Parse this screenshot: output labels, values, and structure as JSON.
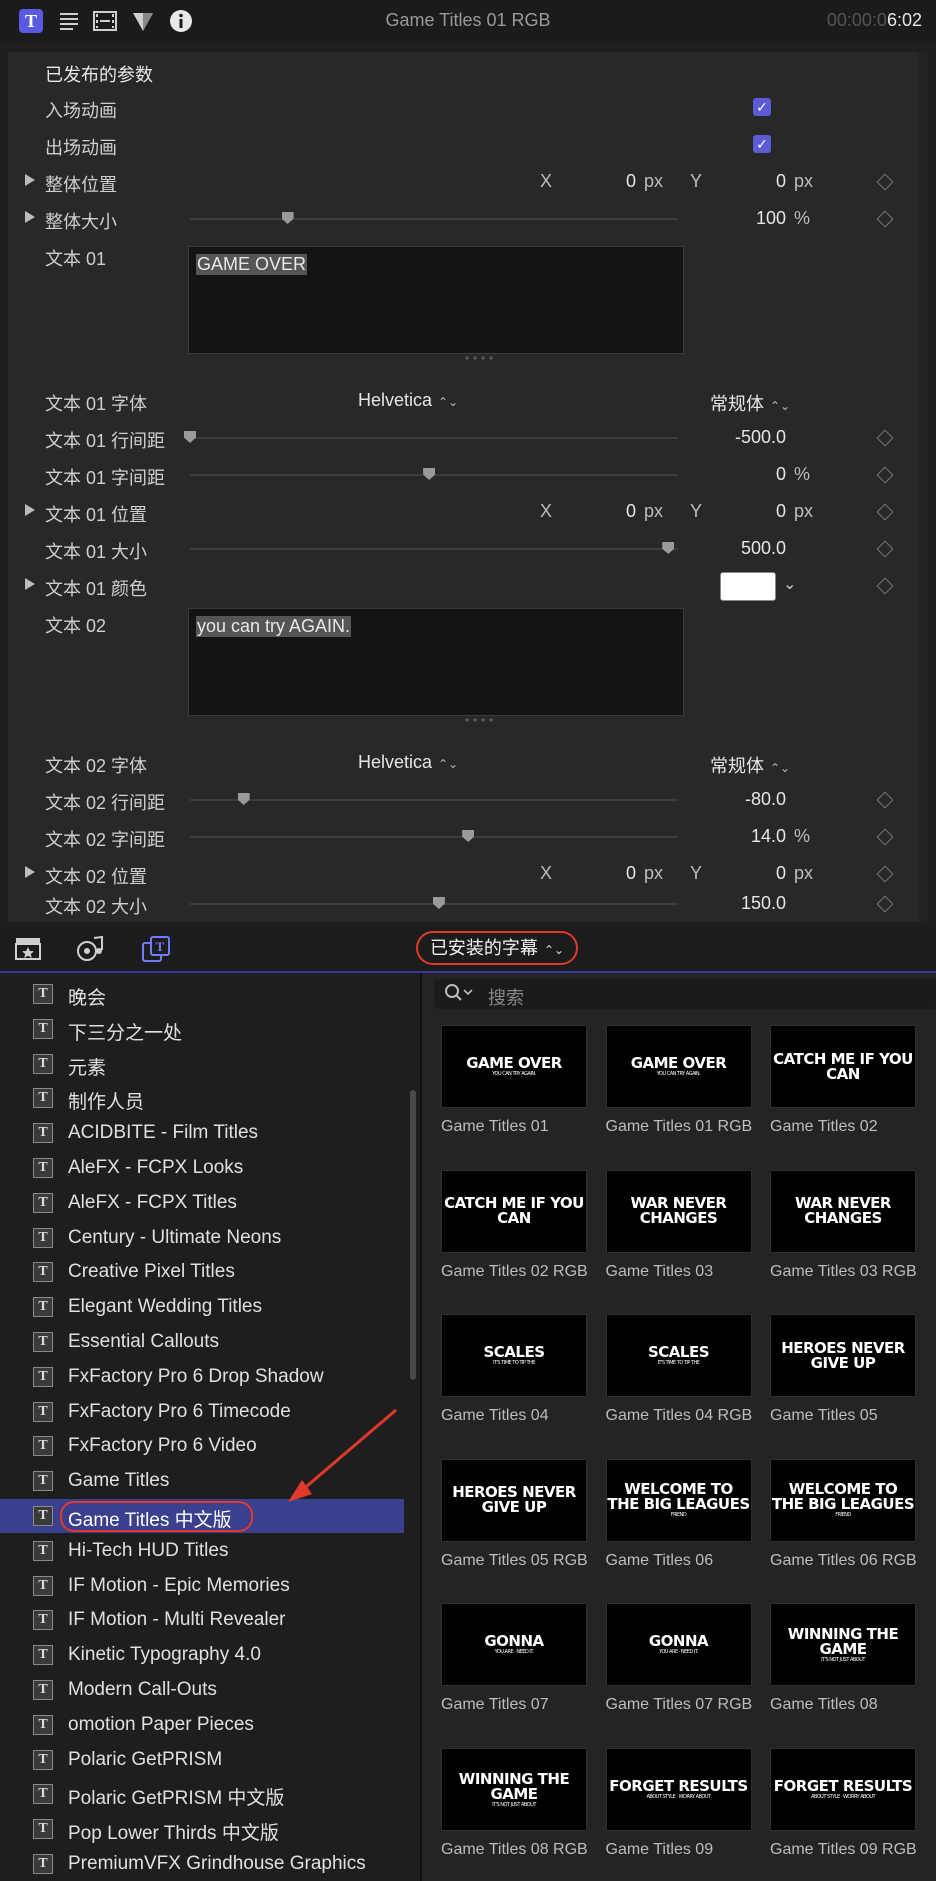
{
  "titlebar": {
    "title": "Game Titles 01 RGB",
    "time_dim": "00:00:0",
    "time_bright": "6:02",
    "icons": [
      "titles-tab-icon",
      "text-tab-icon",
      "video-tab-icon",
      "color-tab-icon",
      "info-tab-icon"
    ]
  },
  "inspector": {
    "section_title": "已发布的参数",
    "in_anim": "入场动画",
    "out_anim": "出场动画",
    "overall_pos": "整体位置",
    "overall_size": "整体大小",
    "overall_size_value": "100",
    "text01": "文本 01",
    "text01_content": "GAME OVER",
    "text01_font": "文本 01 字体",
    "text01_line": "文本 01 行间距",
    "text01_line_value": "-500.0",
    "text01_track": "文本 01 字间距",
    "text01_track_value": "0",
    "text01_pos": "文本 01 位置",
    "text01_size": "文本 01 大小",
    "text01_size_value": "500.0",
    "text01_color": "文本 01 颜色",
    "text02": "文本 02",
    "text02_content": "you can try AGAIN.",
    "text02_font": "文本 02 字体",
    "text02_line": "文本 02 行间距",
    "text02_line_value": "-80.0",
    "text02_track": "文本 02 字间距",
    "text02_track_value": "14.0",
    "text02_pos": "文本 02 位置",
    "text02_size": "文本 02 大小",
    "text02_size_value": "150.0",
    "font_name": "Helvetica",
    "font_style": "常规体",
    "x": "X",
    "y": "Y",
    "zero": "0",
    "px": "px",
    "percent": "%",
    "checkbox_checked": "✓",
    "slider_levels": {
      "overall_size": 0.2,
      "text01_line": 0.0,
      "text01_track": 0.49,
      "text01_size": 0.98,
      "text02_line": 0.11,
      "text02_track": 0.57,
      "text02_size": 0.51
    }
  },
  "browser": {
    "category_select": "已安装的字幕",
    "search_placeholder": "搜索",
    "sidebar_items": [
      "晚会",
      "下三分之一处",
      "元素",
      "制作人员",
      "ACIDBITE - Film Titles",
      "AleFX - FCPX Looks",
      "AleFX - FCPX Titles",
      "Century - Ultimate Neons",
      "Creative Pixel Titles",
      "Elegant Wedding Titles",
      "Essential Callouts",
      "FxFactory Pro 6 Drop Shadow",
      "FxFactory Pro 6 Timecode",
      "FxFactory Pro 6 Video",
      "Game Titles",
      "Game Titles 中文版",
      "Hi-Tech HUD Titles",
      "IF Motion - Epic Memories",
      "IF Motion - Multi Revealer",
      "Kinetic Typography 4.0",
      "Modern Call-Outs",
      "omotion Paper Pieces",
      "Polaric GetPRISM",
      "Polaric GetPRISM 中文版",
      "Pop Lower Thirds 中文版",
      "PremiumVFX Grindhouse Graphics"
    ],
    "selected_item": "Game Titles 中文版",
    "tiles": [
      {
        "name": "Game Titles 01",
        "big": "GAME OVER",
        "small": "YOU CAN TRY AGAIN."
      },
      {
        "name": "Game Titles 01 RGB",
        "big": "GAME OVER",
        "small": "YOU CAN TRY AGAIN."
      },
      {
        "name": "Game Titles 02",
        "big": "CATCH ME IF YOU CAN",
        "small": ""
      },
      {
        "name": "Game Titles 02 RGB",
        "big": "CATCH ME IF YOU CAN",
        "small": ""
      },
      {
        "name": "Game Titles 03",
        "big": "WAR NEVER CHANGES",
        "small": ""
      },
      {
        "name": "Game Titles 03 RGB",
        "big": "WAR NEVER CHANGES",
        "small": ""
      },
      {
        "name": "Game Titles 04",
        "big": "SCALES",
        "small": "IT'S TIME TO TIP THE"
      },
      {
        "name": "Game Titles 04 RGB",
        "big": "SCALES",
        "small": "IT'S TIME TO TIP THE"
      },
      {
        "name": "Game Titles 05",
        "big": "HEROES NEVER GIVE UP",
        "small": ""
      },
      {
        "name": "Game Titles 05 RGB",
        "big": "HEROES NEVER GIVE UP",
        "small": ""
      },
      {
        "name": "Game Titles 06",
        "big": "WELCOME TO THE BIG LEAGUES",
        "small": "FRIEND"
      },
      {
        "name": "Game Titles 06 RGB",
        "big": "WELCOME TO THE BIG LEAGUES",
        "small": "FRIEND"
      },
      {
        "name": "Game Titles 07",
        "big": "GONNA",
        "small": "YOU ARE · NEED IT."
      },
      {
        "name": "Game Titles 07 RGB",
        "big": "GONNA",
        "small": "YOU ARE · NEED IT."
      },
      {
        "name": "Game Titles 08",
        "big": "WINNING THE GAME",
        "small": "IT'S NOT JUST ABOUT"
      },
      {
        "name": "Game Titles 08 RGB",
        "big": "WINNING THE GAME",
        "small": "IT'S NOT JUST ABOUT"
      },
      {
        "name": "Game Titles 09",
        "big": "FORGET RESULTS",
        "small": "ABOUT STYLE · WORRY ABOUT"
      },
      {
        "name": "Game Titles 09 RGB",
        "big": "FORGET RESULTS",
        "small": "ABOUT STYLE · WORRY ABOUT"
      }
    ]
  },
  "colors": {
    "accent": "#5a5ae0",
    "highlight_ring": "#e23a2a",
    "selection": "#3a3f8e",
    "swatch": "#ffffff"
  }
}
